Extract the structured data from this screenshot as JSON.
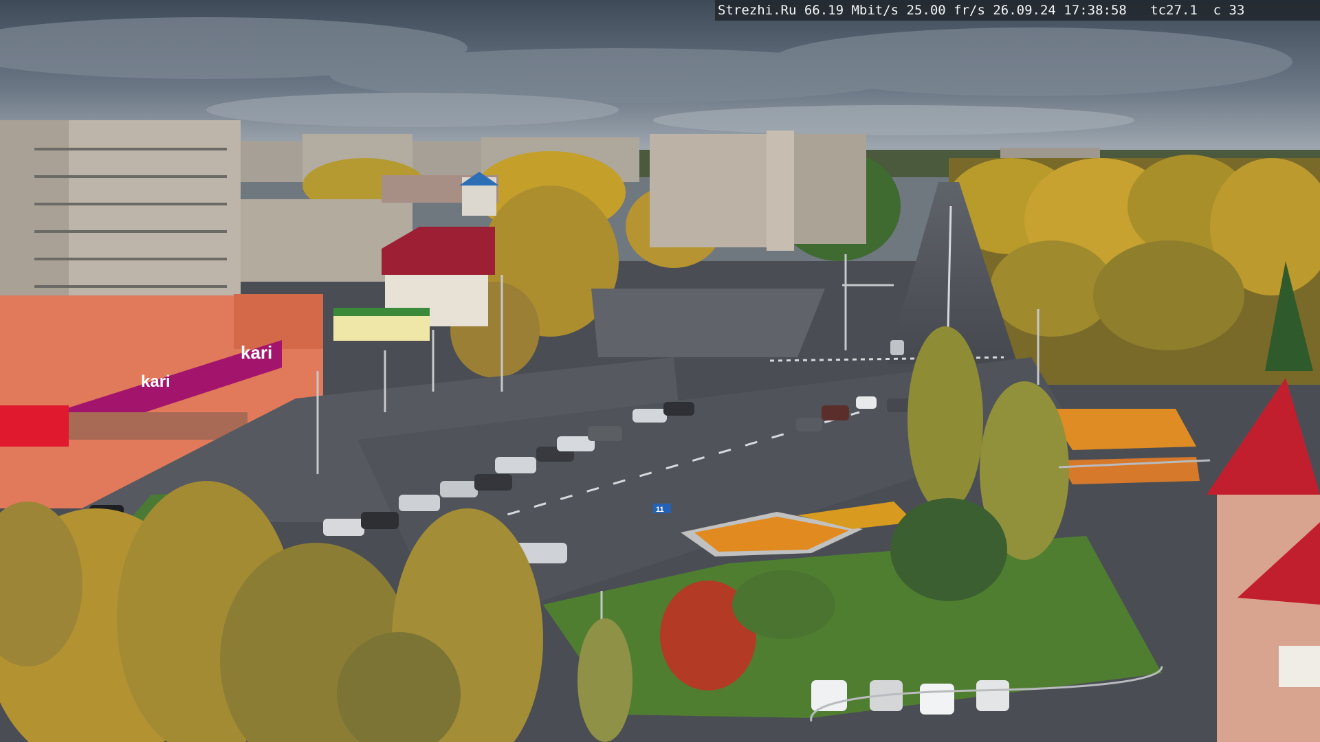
{
  "overlay": {
    "caption": "Strezhi.Ru 66.19 Mbit/s 25.00 fr/s 26.09.24 17:38:58   tc27.1  c 33"
  },
  "signs": {
    "store_logo": "kari",
    "store_banner": "kari",
    "route_marker": "11"
  },
  "colors": {
    "sky": "#596574",
    "clouds": "#7d8894",
    "asphalt": "#4c5056",
    "grass": "#4d7d33",
    "autumn_yellow": "#c9a429",
    "store_magenta": "#a3146c",
    "roof_red": "#c21f2e"
  }
}
